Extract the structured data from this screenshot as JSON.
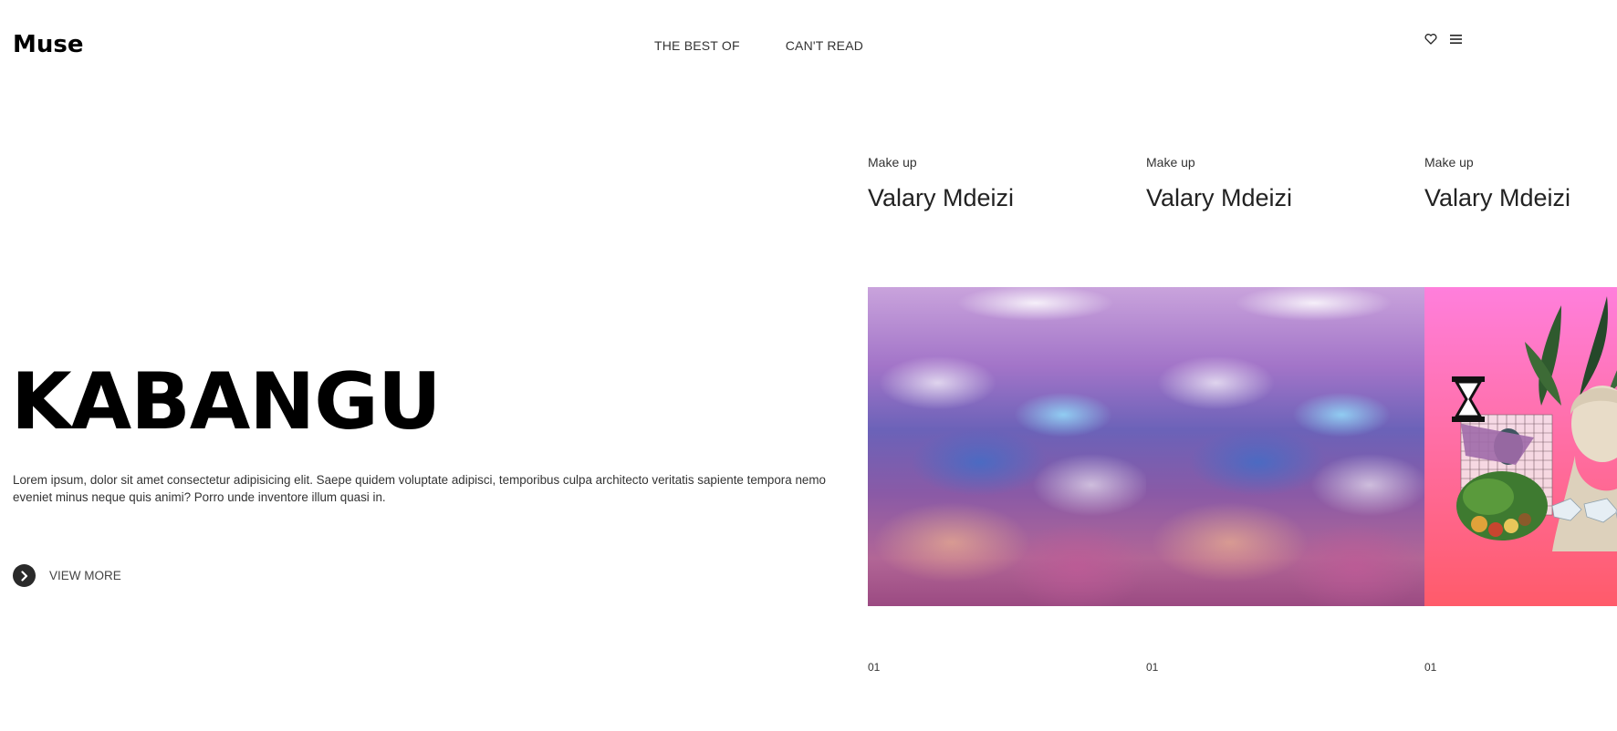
{
  "brand": {
    "logo": "Muse"
  },
  "nav": {
    "items": [
      {
        "label": "THE BEST OF"
      },
      {
        "label": "CAN'T READ"
      }
    ]
  },
  "top_icons": {
    "wishlist": "heart-icon",
    "menu": "hamburger-menu-icon"
  },
  "hero": {
    "title": "KABANGU",
    "description": "Lorem ipsum, dolor sit amet consectetur adipisicing elit. Saepe quidem voluptate adipisci, temporibus culpa architecto veritatis sapiente tempora nemo eveniet minus neque quis animi? Porro unde inventore illum quasi in.",
    "cta_label": "VIEW MORE",
    "cta_icon": "chevron-right-icon"
  },
  "cards": [
    {
      "category": "Make up",
      "name": "Valary Mdeizi",
      "number": "01",
      "image": "iridescent-water-image"
    },
    {
      "category": "Make up",
      "name": "Valary Mdeizi",
      "number": "01",
      "image": "iridescent-water-image"
    },
    {
      "category": "Make up",
      "name": "Valary Mdeizi",
      "number": "01",
      "image": "vaporwave-collage-image"
    }
  ],
  "colors": {
    "background": "#ffffff",
    "text": "#111111",
    "cta_circle": "#2a2a2a"
  }
}
